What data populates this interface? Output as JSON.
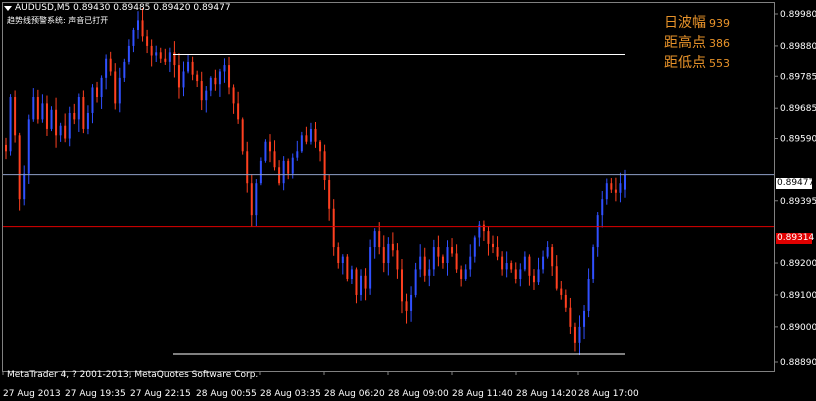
{
  "header": {
    "symbol_line": "AUDUSD,M5  0.89430 0.89485 0.89420 0.89477",
    "alert_line": "趋势线预警系统: 声音已打开"
  },
  "stats_panel": {
    "items": [
      {
        "label": "日波幅",
        "value": "939"
      },
      {
        "label": "距高点",
        "value": "386"
      },
      {
        "label": "距低点",
        "value": "553"
      }
    ]
  },
  "copyright": "MetaTrader 4, ? 2001-2013, MetaQuotes Software Corp.",
  "colors": {
    "background": "#000000",
    "bull_candle": "#3050ff",
    "bear_candle": "#ff4020",
    "bid_line": "#8fa0c8",
    "trend_line_red": "#e00000",
    "hline_white": "#ffffff",
    "stats_text": "#e8932a"
  },
  "chart_data": {
    "type": "candlestick",
    "symbol": "AUDUSD",
    "timeframe": "M5",
    "ohlc_current": {
      "open": 0.8943,
      "high": 0.89485,
      "low": 0.8942,
      "close": 0.89477
    },
    "y_ticks": [
      "0.89980",
      "0.89880",
      "0.89785",
      "0.89685",
      "0.89590",
      "0.89477",
      "0.89395",
      "0.89314",
      "0.89200",
      "0.89100",
      "0.89000",
      "0.88890"
    ],
    "y_tick_values": [
      0.8998,
      0.8988,
      0.89785,
      0.89685,
      0.8959,
      0.89395,
      0.892,
      0.891,
      0.89,
      0.8889
    ],
    "current_price_label": "0.89477",
    "current_price": 0.89477,
    "red_line_label": "0.89314",
    "red_line_price": 0.89314,
    "high_line_price": 0.89853,
    "low_line_price": 0.88915,
    "x_ticks": [
      "27 Aug 2013",
      "27 Aug 19:35",
      "27 Aug 22:15",
      "28 Aug 00:55",
      "28 Aug 03:35",
      "28 Aug 06:20",
      "28 Aug 09:00",
      "28 Aug 11:40",
      "28 Aug 14:20",
      "28 Aug 17:00"
    ],
    "ylim": [
      0.8887,
      0.9003
    ],
    "close_path": [
      0.8955,
      0.8972,
      0.896,
      0.894,
      0.8948,
      0.8965,
      0.8972,
      0.8965,
      0.897,
      0.8962,
      0.8968,
      0.896,
      0.8963,
      0.8959,
      0.8967,
      0.8965,
      0.8972,
      0.8962,
      0.8967,
      0.8975,
      0.8972,
      0.8978,
      0.8984,
      0.898,
      0.897,
      0.8978,
      0.8983,
      0.8988,
      0.8993,
      0.8996,
      0.8991,
      0.8988,
      0.8985,
      0.8986,
      0.8984,
      0.8983,
      0.8986,
      0.8982,
      0.8975,
      0.898,
      0.8983,
      0.8979,
      0.8977,
      0.8971,
      0.8974,
      0.8978,
      0.8976,
      0.898,
      0.8982,
      0.8975,
      0.897,
      0.8965,
      0.8955,
      0.8945,
      0.8935,
      0.8945,
      0.8952,
      0.8958,
      0.8955,
      0.895,
      0.8945,
      0.8952,
      0.8948,
      0.8953,
      0.8955,
      0.896,
      0.8958,
      0.8962,
      0.8958,
      0.8955,
      0.8946,
      0.8937,
      0.8925,
      0.892,
      0.8922,
      0.8915,
      0.8918,
      0.891,
      0.8916,
      0.8912,
      0.8925,
      0.893,
      0.8925,
      0.892,
      0.8926,
      0.8924,
      0.8918,
      0.8908,
      0.8905,
      0.891,
      0.8918,
      0.8922,
      0.8916,
      0.8918,
      0.8925,
      0.8922,
      0.892,
      0.8925,
      0.8923,
      0.8918,
      0.8915,
      0.8918,
      0.8922,
      0.8928,
      0.8932,
      0.893,
      0.8926,
      0.8925,
      0.8922,
      0.8918,
      0.892,
      0.8918,
      0.8915,
      0.8918,
      0.8922,
      0.8916,
      0.8914,
      0.8918,
      0.8922,
      0.8925,
      0.8919,
      0.8912,
      0.891,
      0.8906,
      0.89,
      0.8895,
      0.89,
      0.8905,
      0.8915,
      0.8925,
      0.8935,
      0.894,
      0.8945,
      0.8943,
      0.8942,
      0.8945,
      0.89477
    ]
  }
}
